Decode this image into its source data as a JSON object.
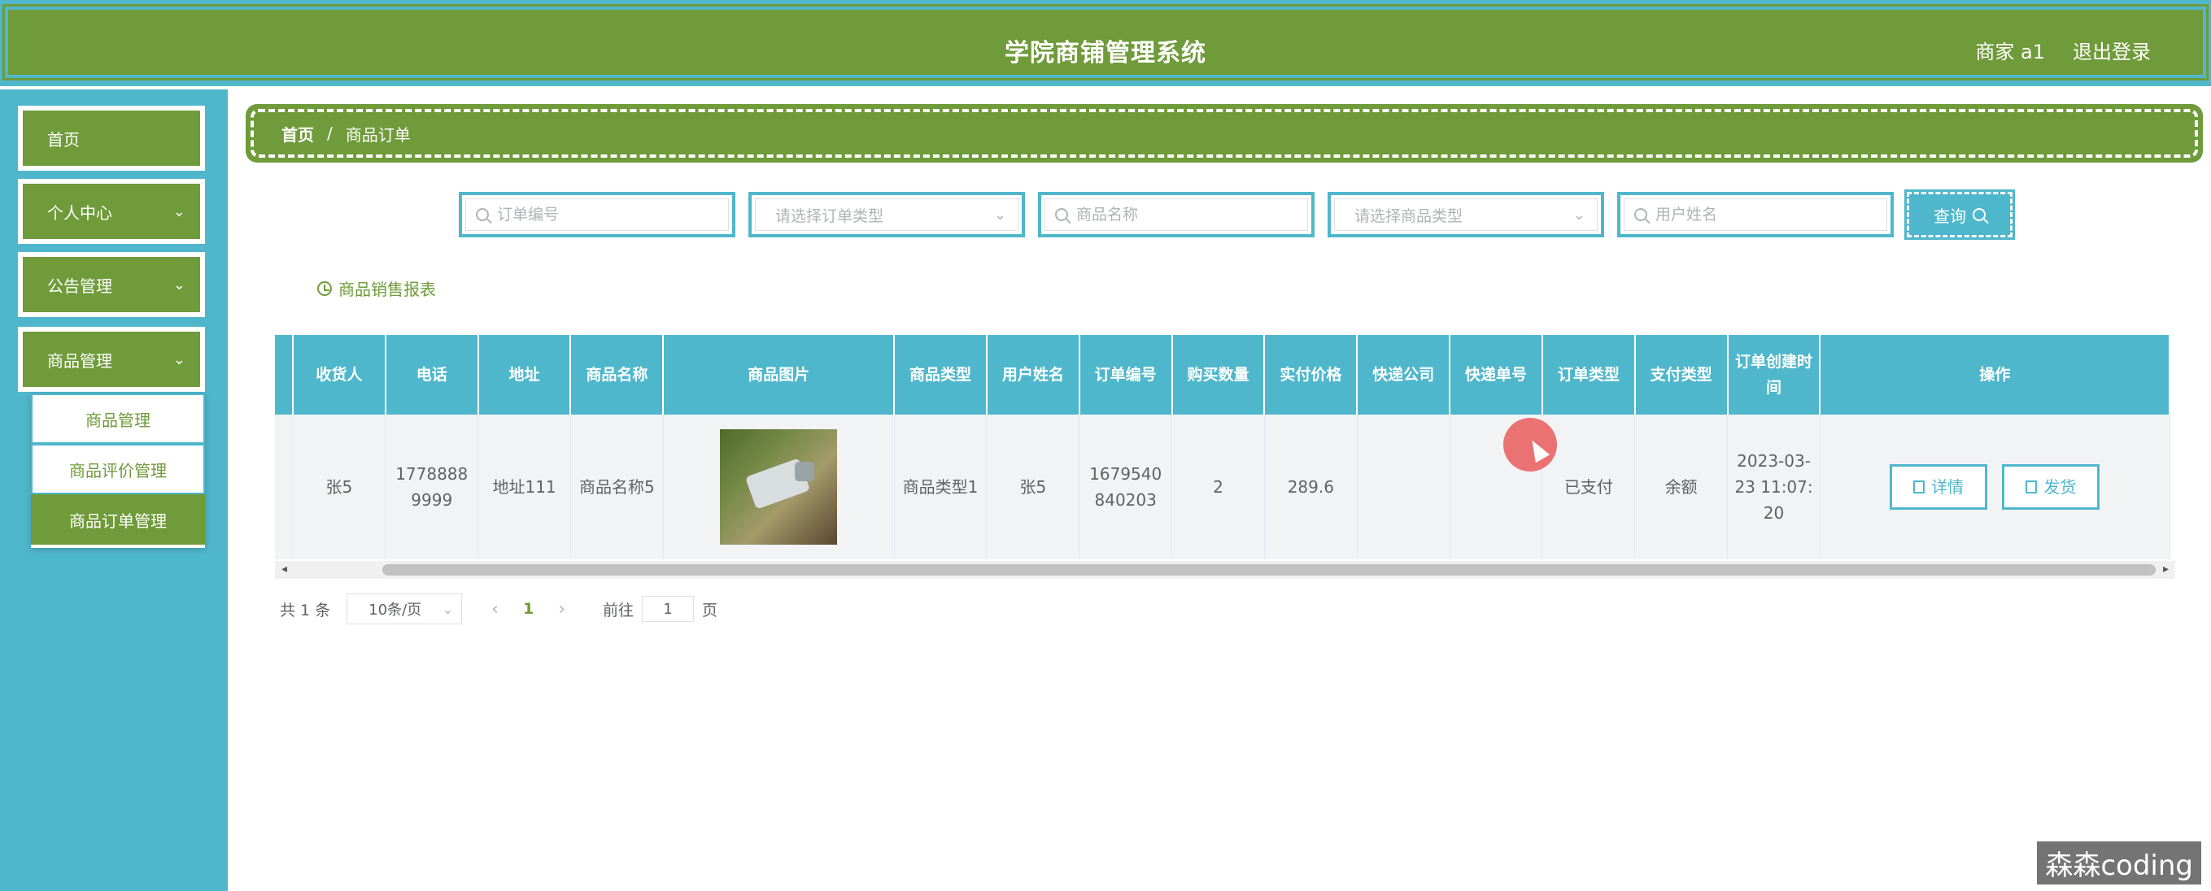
{
  "header": {
    "title": "学院商铺管理系统",
    "user": "商家 a1",
    "logout": "退出登录"
  },
  "sidebar": {
    "items": [
      {
        "label": "首页"
      },
      {
        "label": "个人中心"
      },
      {
        "label": "公告管理"
      },
      {
        "label": "商品管理"
      }
    ],
    "submenu": [
      {
        "label": "商品管理"
      },
      {
        "label": "商品评价管理"
      },
      {
        "label": "商品订单管理"
      }
    ]
  },
  "breadcrumb": {
    "home": "首页",
    "sep": "/",
    "current": "商品订单"
  },
  "search": {
    "order_no_placeholder": "订单编号",
    "order_type_placeholder": "请选择订单类型",
    "product_name_placeholder": "商品名称",
    "product_type_placeholder": "请选择商品类型",
    "user_name_placeholder": "用户姓名",
    "query_label": "查询"
  },
  "report_link": "商品销售报表",
  "table": {
    "headers": [
      "收货人",
      "电话",
      "地址",
      "商品名称",
      "商品图片",
      "商品类型",
      "用户姓名",
      "订单编号",
      "购买数量",
      "实付价格",
      "快递公司",
      "快递单号",
      "订单类型",
      "支付类型",
      "订单创建时间",
      "操作"
    ],
    "rows": [
      {
        "receiver": "张5",
        "phone": "17788889999",
        "address": "地址111",
        "product_name": "商品名称5",
        "product_type": "商品类型1",
        "user_name": "张5",
        "order_no": "1679540840203",
        "quantity": "2",
        "price": "289.6",
        "courier": "",
        "tracking_no": "",
        "order_type": "已支付",
        "pay_type": "余额",
        "created": "2023-03-23 11:07:20",
        "detail_label": "详情",
        "ship_label": "发货"
      }
    ]
  },
  "pagination": {
    "total": "共 1 条",
    "page_size": "10条/页",
    "current_page": "1",
    "goto_label": "前往",
    "goto_value": "1",
    "page_suffix": "页"
  },
  "watermark": "森森coding",
  "colors": {
    "primary_green": "#6f9b3a",
    "accent_cyan": "#4fb7cc"
  }
}
